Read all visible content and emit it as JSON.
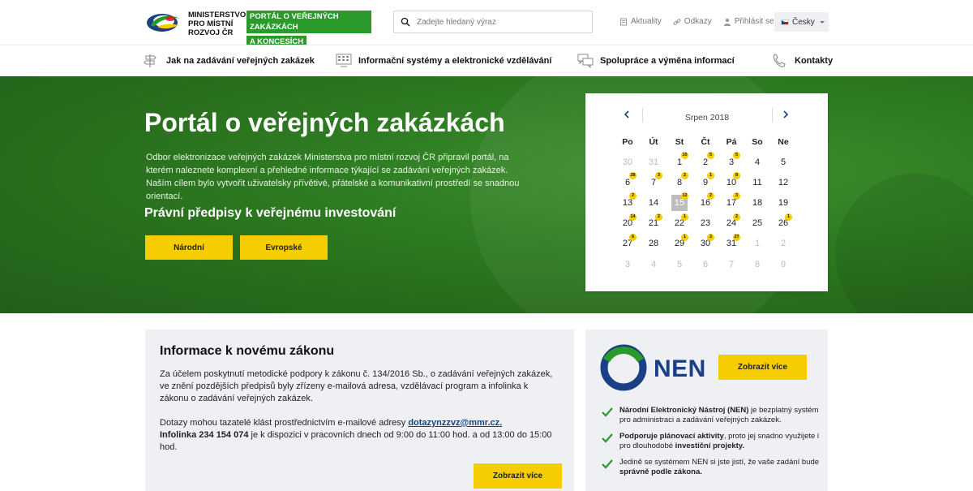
{
  "header": {
    "logo_text": "Ministerstvo pro místní rozvoj ČR",
    "portal_badge_line1": "PORTÁL O VEŘEJNÝCH ZAKÁZKÁCH",
    "portal_badge_line2": "A KONCESÍCH",
    "search_placeholder": "Zadejte hledaný výraz",
    "links": [
      {
        "label": "Aktuality",
        "icon": "document-icon"
      },
      {
        "label": "Odkazy",
        "icon": "link-icon"
      },
      {
        "label": "Přihlásit se",
        "icon": "user-icon"
      }
    ],
    "language": "Česky"
  },
  "nav": {
    "items": [
      {
        "label": "Jak na zadávání veřejných zakázek",
        "icon": "signpost-icon"
      },
      {
        "label": "Informační systémy a elektronické vzdělávání",
        "icon": "computer-icon"
      },
      {
        "label": "Spolupráce a výměna informací",
        "icon": "chat-icon"
      },
      {
        "label": "Kontakty",
        "icon": "phone-icon"
      }
    ]
  },
  "hero": {
    "title": "Portál o veřejných zakázkách",
    "text": "Odbor elektronizace veřejných zakázek Ministerstva pro místní rozvoj ČR připravil portál, na kterém naleznete komplexní a přehledné informace týkající se zadávání veřejných zakázek. Naším cílem bylo vytvořit uživatelsky přívětivé, přátelské a komunikativní prostředí se snadnou orientací.",
    "subtitle": "Právní předpisy k veřejnému investování",
    "btn_narodni": "Národní",
    "btn_evropske": "Evropské",
    "color_green": "#2d7a23"
  },
  "calendar": {
    "month": "Srpen 2018",
    "dow": [
      "Po",
      "Út",
      "St",
      "Čt",
      "Pá",
      "So",
      "Ne"
    ],
    "weeks": [
      [
        {
          "d": "30",
          "m": true
        },
        {
          "d": "31",
          "m": true
        },
        {
          "d": "1",
          "b": "10"
        },
        {
          "d": "2",
          "b": "5"
        },
        {
          "d": "3",
          "b": "5"
        },
        {
          "d": "4"
        },
        {
          "d": "5"
        }
      ],
      [
        {
          "d": "6",
          "b": "28"
        },
        {
          "d": "7",
          "b": "3"
        },
        {
          "d": "8",
          "b": "2"
        },
        {
          "d": "9",
          "b": "1"
        },
        {
          "d": "10",
          "b": "8"
        },
        {
          "d": "11"
        },
        {
          "d": "12"
        }
      ],
      [
        {
          "d": "13",
          "b": "2"
        },
        {
          "d": "14"
        },
        {
          "d": "15",
          "b": "12",
          "today": true
        },
        {
          "d": "16",
          "b": "2"
        },
        {
          "d": "17",
          "b": "3"
        },
        {
          "d": "18"
        },
        {
          "d": "19"
        }
      ],
      [
        {
          "d": "20",
          "b": "14"
        },
        {
          "d": "21",
          "b": "2"
        },
        {
          "d": "22",
          "b": "1"
        },
        {
          "d": "23"
        },
        {
          "d": "24",
          "b": "2"
        },
        {
          "d": "25"
        },
        {
          "d": "26",
          "b": "1"
        }
      ],
      [
        {
          "d": "27",
          "b": "6"
        },
        {
          "d": "28"
        },
        {
          "d": "29",
          "b": "1"
        },
        {
          "d": "30",
          "b": "3"
        },
        {
          "d": "31",
          "b": "27"
        },
        {
          "d": "1",
          "m": true
        },
        {
          "d": "2",
          "m": true
        }
      ],
      [
        {
          "d": "3",
          "m": true
        },
        {
          "d": "4",
          "m": true
        },
        {
          "d": "5",
          "m": true
        },
        {
          "d": "6",
          "m": true
        },
        {
          "d": "7",
          "m": true
        },
        {
          "d": "8",
          "m": true
        },
        {
          "d": "9",
          "m": true
        }
      ]
    ]
  },
  "info": {
    "title": "Informace k novému zákonu",
    "p1": "Za účelem poskytnutí metodické podpory k zákonu č. 134/2016 Sb., o zadávání veřejných zakázek, ve znění pozdějších předpisů byly zřízeny e-mailová adresa, vzdělávací program a infolinka k zákonu o zadávání veřejných zakázek.",
    "p2_pre": "Dotazy mohou tazatelé klást prostřednictvím e-mailové adresy ",
    "p2_email": "dotazynzzvz@mmr.cz.",
    "p2_infolinka": "Infolinka 234 154 074",
    "p2_post": " je k dispozici v pracovních dnech od 9:00 do 11:00 hod.  a od 13:00 do 15:00 hod.",
    "btn": "Zobrazit více"
  },
  "nen": {
    "logo_text": "NEN",
    "btn": "Zobrazit více",
    "items": [
      {
        "bold": "Národní Elektronický Nástroj (NEN)",
        "rest": " je bezplatný systém pro administraci a zadávání veřejných zakázek."
      },
      {
        "bold": "Podporuje plánovací aktivity",
        "rest": ", proto jej snadno využijete i pro dlouhodobé ",
        "bold2": "investiční projekty."
      },
      {
        "pre": "Jedině se systémem NEN si jste jistí, že vaše zadání bude ",
        "bold": "správně podle zákona."
      }
    ]
  }
}
